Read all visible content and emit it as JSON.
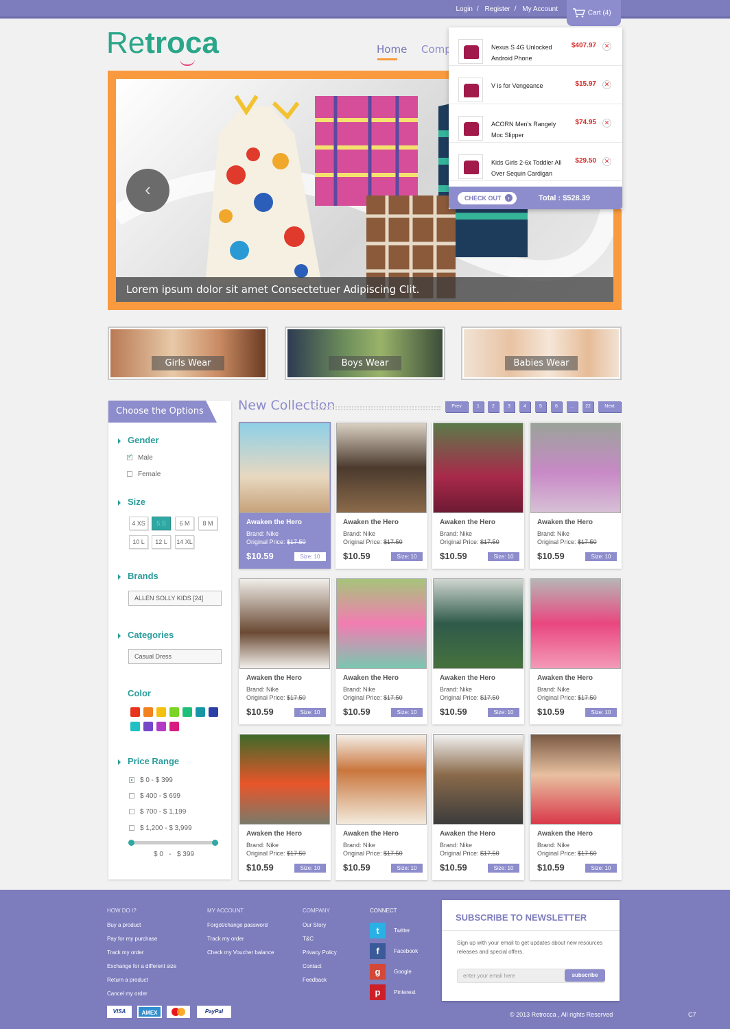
{
  "topbar": {
    "login": "Login",
    "register": "Register",
    "account": "My Account",
    "cart_label": "Cart (4)",
    "separator": "/"
  },
  "logo": {
    "part1": "Re",
    "part2": "troca"
  },
  "nav": {
    "home": "Home",
    "second": "Compr"
  },
  "slider": {
    "caption": "Lorem ipsum dolor sit amet Consectetuer Adipiscing Clit.",
    "prev_glyph": "‹"
  },
  "cart": {
    "items": [
      {
        "name": "Nexus S 4G Unlocked Android Phone",
        "price": "$407.97"
      },
      {
        "name": "V is for Vengeance",
        "price": "$15.97"
      },
      {
        "name": "ACORN Men's Rangely Moc Slipper",
        "price": "$74.95"
      },
      {
        "name": "Kids Girls 2-6x Toddler All Over Sequin Cardigan",
        "price": "$29.50"
      }
    ],
    "checkout": "CHECK OUT",
    "total": "Total :  $528.39",
    "remove_glyph": "✕",
    "checkout_glyph": "›"
  },
  "categories": [
    {
      "label": "Girls Wear"
    },
    {
      "label": "Boys Wear"
    },
    {
      "label": "Babies Wear"
    }
  ],
  "sidebar": {
    "title": "Choose the Options",
    "gender": {
      "label": "Gender",
      "options": [
        "Male",
        "Female"
      ]
    },
    "size": {
      "label": "Size",
      "options": [
        "4 XS",
        "5 S",
        "6 M",
        "8 M",
        "10 L",
        "12 L",
        "14 XL"
      ],
      "selected": "5 S"
    },
    "brands": {
      "label": "Brands",
      "value": "ALLEN SOLLY KIDS [24]"
    },
    "categories": {
      "label": "Categories",
      "value": "Casual Dress"
    },
    "color": {
      "label": "Color",
      "swatches": [
        "#e8341c",
        "#f2821f",
        "#f5c10e",
        "#7bd424",
        "#1fbf7a",
        "#1796a8",
        "#2c3fa6",
        "#21c0c4",
        "#7448c9",
        "#b23bc6",
        "#d81b80"
      ]
    },
    "price": {
      "label": "Price Range",
      "options": [
        "$ 0 - $ 399",
        "$ 400 - $ 699",
        "$ 700 - $ 1,199",
        "$ 1,200 - $ 3,999"
      ],
      "range_min": "$ 0",
      "range_sep": "-",
      "range_max": "$ 399"
    }
  },
  "collection": {
    "title": "New Collection",
    "pagination": [
      "Prev",
      "1",
      "2",
      "3",
      "4",
      "5",
      "6",
      "...",
      "22",
      "Next"
    ]
  },
  "products": {
    "title": "Awaken the Hero",
    "brand": "Brand: Nike",
    "orig_label": "Original Price:",
    "orig_price": "$17.50",
    "price": "$10.59",
    "size": "Size: 10"
  },
  "footer": {
    "howdo": {
      "head": "HOW DO I?",
      "links": [
        "Buy a  product",
        "Pay for my purchase",
        "Track my order",
        "Exchange for a different size",
        "Return a product",
        "Cancel my order"
      ]
    },
    "account": {
      "head": "MY ACCOUNT",
      "links": [
        "Forgot/change password",
        "Track my order",
        "Check my Voucher balance"
      ]
    },
    "company": {
      "head": "COMPANY",
      "links": [
        "Our Story",
        "T&C",
        "Privacy Policy",
        "Contact",
        "Feedback"
      ]
    },
    "connect": {
      "head": "CONNECT",
      "links": [
        "Twitter",
        "Facebook",
        "Google",
        "Pinterest"
      ]
    },
    "newsletter": {
      "title": "SUBSCRIBE TO NEWSLETTER",
      "text": "Sign up with your email to get updates about new resources releases and special offers.",
      "placeholder": "enter your email here",
      "button": "subscribe"
    },
    "payments": [
      "VISA",
      "AMEX",
      "MC",
      "PayPal"
    ],
    "copyright": "© 2013  Retrocca , All rights Reserved",
    "code": "C7"
  }
}
